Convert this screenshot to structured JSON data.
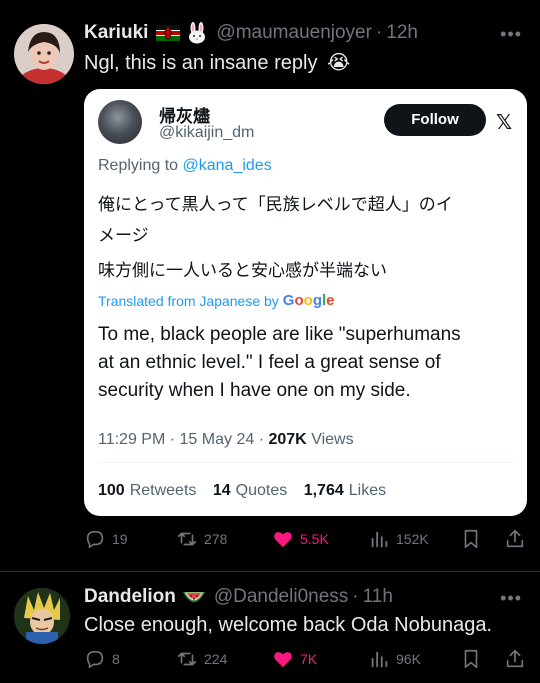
{
  "reply1": {
    "name": "Kariuki",
    "flag_icon": "kenya-flag-icon",
    "emoji_icon": "rabbit-face-icon",
    "handle": "@maumauenjoyer",
    "sep": "·",
    "time": "12h",
    "text": "Ngl, this is an insane reply",
    "text_emoji": "😭",
    "quote": {
      "name": "帰灰燼",
      "handle": "@kikaijin_dm",
      "follow_label": "Follow",
      "replying_prefix": "Replying to",
      "replying_to": "@kana_ides",
      "jp_line1": "俺にとって黒人って「民族レベルで超人」のイ",
      "jp_line2": "メージ",
      "jp_line3": "味方側に一人いると安心感が半端ない",
      "translated_label": "Translated from Japanese by",
      "google_label": "Google",
      "en_line1": "To me, black people are like \"superhumans",
      "en_line2": "at an ethnic level.\" I feel a great sense of",
      "en_line3": "security when I have one on my side.",
      "time": "11:29 PM",
      "date": "15 May 24",
      "views_count": "207K",
      "views_label": "Views",
      "retweets_count": "100",
      "retweets_label": "Retweets",
      "quotes_count": "14",
      "quotes_label": "Quotes",
      "likes_count": "1,764",
      "likes_label": "Likes"
    },
    "actions": {
      "replies": "19",
      "reposts": "278",
      "likes": "5.5K",
      "views": "152K"
    }
  },
  "reply2": {
    "name": "Dandelion",
    "emoji_icon": "watermelon-icon",
    "handle": "@Dandeli0ness",
    "sep": "·",
    "time": "11h",
    "text": "Close enough, welcome back Oda Nobunaga.",
    "actions": {
      "replies": "8",
      "reposts": "224",
      "likes": "7K",
      "views": "96K"
    }
  },
  "colors": {
    "background": "#000000",
    "text": "#e7e9ea",
    "muted": "#71767b",
    "link": "#1d9bf0",
    "like": "#f91880"
  }
}
